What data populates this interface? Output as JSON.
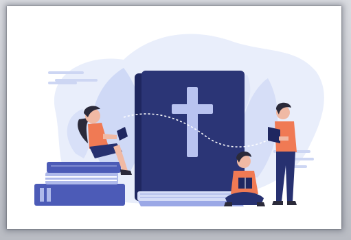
{
  "illustration": {
    "subject": "bible-reading-illustration",
    "colors": {
      "background": "#ffffff",
      "blob": "#e9eefb",
      "leaf": "#cfd9f6",
      "book_cover": "#2b3576",
      "book_dark": "#1f2760",
      "cross": "#b9c3f0",
      "skin": "#f0b9a4",
      "shirt": "#f07a54",
      "pants": "#273170",
      "hair": "#2b2a3a",
      "small_books_blue": "#4c5bb7",
      "small_books_pale": "#aeb9ea"
    }
  }
}
